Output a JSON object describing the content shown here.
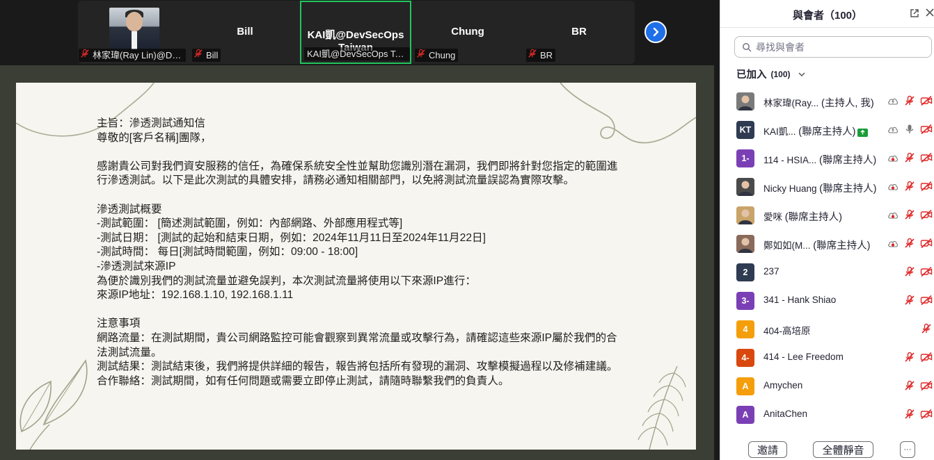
{
  "video_strip": {
    "tiles": [
      {
        "name": "",
        "label": "林家瑋(Ray Lin)@DevSecOps Taiwan",
        "muted": true,
        "has_photo": true
      },
      {
        "name": "Bill",
        "label": "Bill",
        "muted": true
      },
      {
        "name": "KAI凱@DevSecOps Taiwan",
        "label": "KAI凱@DevSecOps Taiwan",
        "muted": false,
        "active": true
      },
      {
        "name": "Chung",
        "label": "Chung",
        "muted": true
      },
      {
        "name": "BR",
        "label": "BR",
        "muted": true
      }
    ],
    "next_icon": "chevron-right-icon"
  },
  "document": {
    "lines": [
      "主旨：滲透測試通知信",
      "尊敬的[客戶名稱]團隊，",
      "",
      "感謝貴公司對我們資安服務的信任，為確保系統安全性並幫助您識別潛在漏洞，我們即將針對您指定的範圍進行滲透測試。以下是此次測試的具體安排，請務必通知相關部門，以免將測試流量誤認為實際攻擊。",
      "",
      "滲透測試概要",
      "-測試範圍： [簡述測試範圍，例如：內部網路、外部應用程式等]",
      "-測試日期： [測試的起始和結束日期，例如：2024年11月11日至2024年11月22日]",
      "-測試時間： 每日[測試時間範圍，例如：09:00 - 18:00]",
      "-滲透測試來源IP",
      "為便於識別我們的測試流量並避免誤判，本次測試流量將使用以下來源IP進行：",
      "來源IP地址：192.168.1.10, 192.168.1.11",
      "",
      "注意事項",
      "網路流量：在測試期間，貴公司網路監控可能會觀察到異常流量或攻擊行為，請確認這些來源IP屬於我們的合法測試流量。",
      "測試結果：測試結束後，我們將提供詳細的報告，報告將包括所有發現的漏洞、攻擊模擬過程以及修補建議。",
      "合作聯絡：測試期間，如有任何問題或需要立即停止測試，請隨時聯繫我們的負責人。"
    ]
  },
  "panel": {
    "title": "與會者（100）",
    "search_placeholder": "尋找與會者",
    "joined_label": "已加入",
    "joined_count": "(100)",
    "participants": [
      {
        "avatar_text": "",
        "avatar_color": "#7a7a7a",
        "photo": true,
        "name": "林家瑋(Ray...",
        "role": "(主持人, 我)",
        "icons": [
          "cloud-icon",
          "mic-off-icon",
          "video-off-icon"
        ]
      },
      {
        "avatar_text": "KT",
        "avatar_color": "#2f3b52",
        "name": "KAI凱...",
        "role": "(聯席主持人)",
        "sharing": true,
        "icons": [
          "cloud-icon",
          "mic-on-icon",
          "video-off-icon"
        ]
      },
      {
        "avatar_text": "1-",
        "avatar_color": "#7b3fb5",
        "name": "114 - HSIA...",
        "role": "(聯席主持人)",
        "icons": [
          "cloud-record-icon",
          "mic-off-icon",
          "video-off-icon"
        ]
      },
      {
        "avatar_text": "",
        "avatar_color": "#4a4a4a",
        "photo": true,
        "name": "Nicky Huang",
        "role": "(聯席主持人)",
        "icons": [
          "cloud-record-icon",
          "mic-off-icon",
          "video-off-icon"
        ]
      },
      {
        "avatar_text": "",
        "avatar_color": "#c9a46a",
        "photo": true,
        "name": "愛咪",
        "role": "(聯席主持人)",
        "icons": [
          "cloud-record-icon",
          "mic-off-icon",
          "video-off-icon"
        ]
      },
      {
        "avatar_text": "",
        "avatar_color": "#8a6a5a",
        "photo": true,
        "name": "鄭如如(M...",
        "role": "(聯席主持人)",
        "icons": [
          "cloud-record-icon",
          "mic-off-icon",
          "video-off-icon"
        ]
      },
      {
        "avatar_text": "2",
        "avatar_color": "#2f3b52",
        "name": "237",
        "role": "",
        "icons": [
          "",
          "mic-off-icon",
          "video-off-icon"
        ]
      },
      {
        "avatar_text": "3-",
        "avatar_color": "#7b3fb5",
        "name": "341 - Hank Shiao",
        "role": "",
        "icons": [
          "",
          "mic-off-icon",
          "video-off-icon"
        ]
      },
      {
        "avatar_text": "4",
        "avatar_color": "#f59e0b",
        "name": "404-高培原",
        "role": "",
        "icons": [
          "",
          "",
          "mic-off-icon"
        ]
      },
      {
        "avatar_text": "4-",
        "avatar_color": "#d9480f",
        "name": "414 - Lee Freedom",
        "role": "",
        "icons": [
          "",
          "mic-off-icon",
          "video-off-icon"
        ]
      },
      {
        "avatar_text": "A",
        "avatar_color": "#f59e0b",
        "name": "Amychen",
        "role": "",
        "icons": [
          "",
          "mic-off-icon",
          "video-off-icon"
        ]
      },
      {
        "avatar_text": "A",
        "avatar_color": "#7b3fb5",
        "name": "AnitaChen",
        "role": "",
        "icons": [
          "",
          "mic-off-icon",
          "video-off-icon"
        ]
      }
    ],
    "footer": {
      "invite_label": "邀請",
      "mute_all_label": "全體靜音",
      "more_label": "···"
    },
    "colors": {
      "mute_red": "#e02828",
      "share_green": "#1a9d3a",
      "active_border": "#22c55e"
    }
  }
}
